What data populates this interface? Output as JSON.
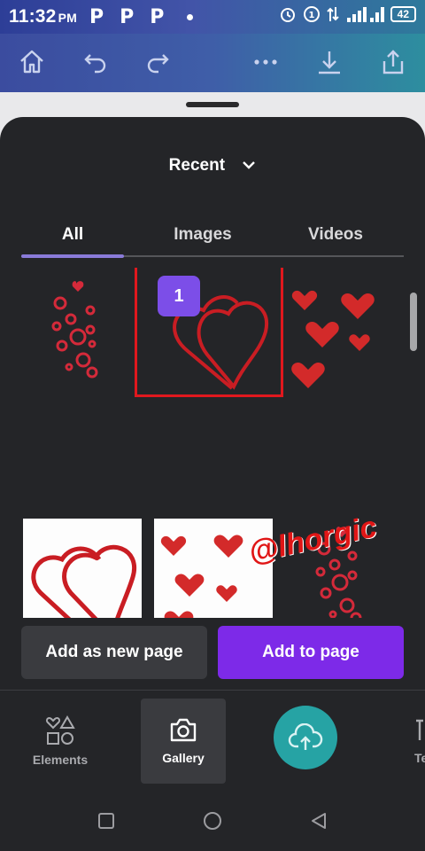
{
  "statusbar": {
    "time": "11:32",
    "ampm": "PM",
    "app_icons": [
      "P",
      "P",
      "P"
    ],
    "battery": "42"
  },
  "toolbar": {
    "icons": [
      "home-icon",
      "undo-icon",
      "redo-icon",
      "more-icon",
      "download-icon",
      "share-icon"
    ]
  },
  "sheet": {
    "dropdown_label": "Recent",
    "tabs": [
      {
        "label": "All",
        "active": true
      },
      {
        "label": "Images",
        "active": false
      },
      {
        "label": "Videos",
        "active": false
      }
    ],
    "selected_count": "1",
    "watermark": "@lhorgic",
    "add_new_page_label": "Add as new page",
    "add_to_page_label": "Add to page"
  },
  "navbar": {
    "items": [
      {
        "label": "Elements",
        "icon": "shapes-icon"
      },
      {
        "label": "Gallery",
        "icon": "camera-icon",
        "active": true
      },
      {
        "label": "Te",
        "icon": "text-icon"
      }
    ]
  },
  "colors": {
    "accent": "#7d2ae8",
    "badge": "#7c4ee8",
    "upload": "#26a3a4",
    "selection": "#e0181e",
    "sheet": "#242528"
  }
}
